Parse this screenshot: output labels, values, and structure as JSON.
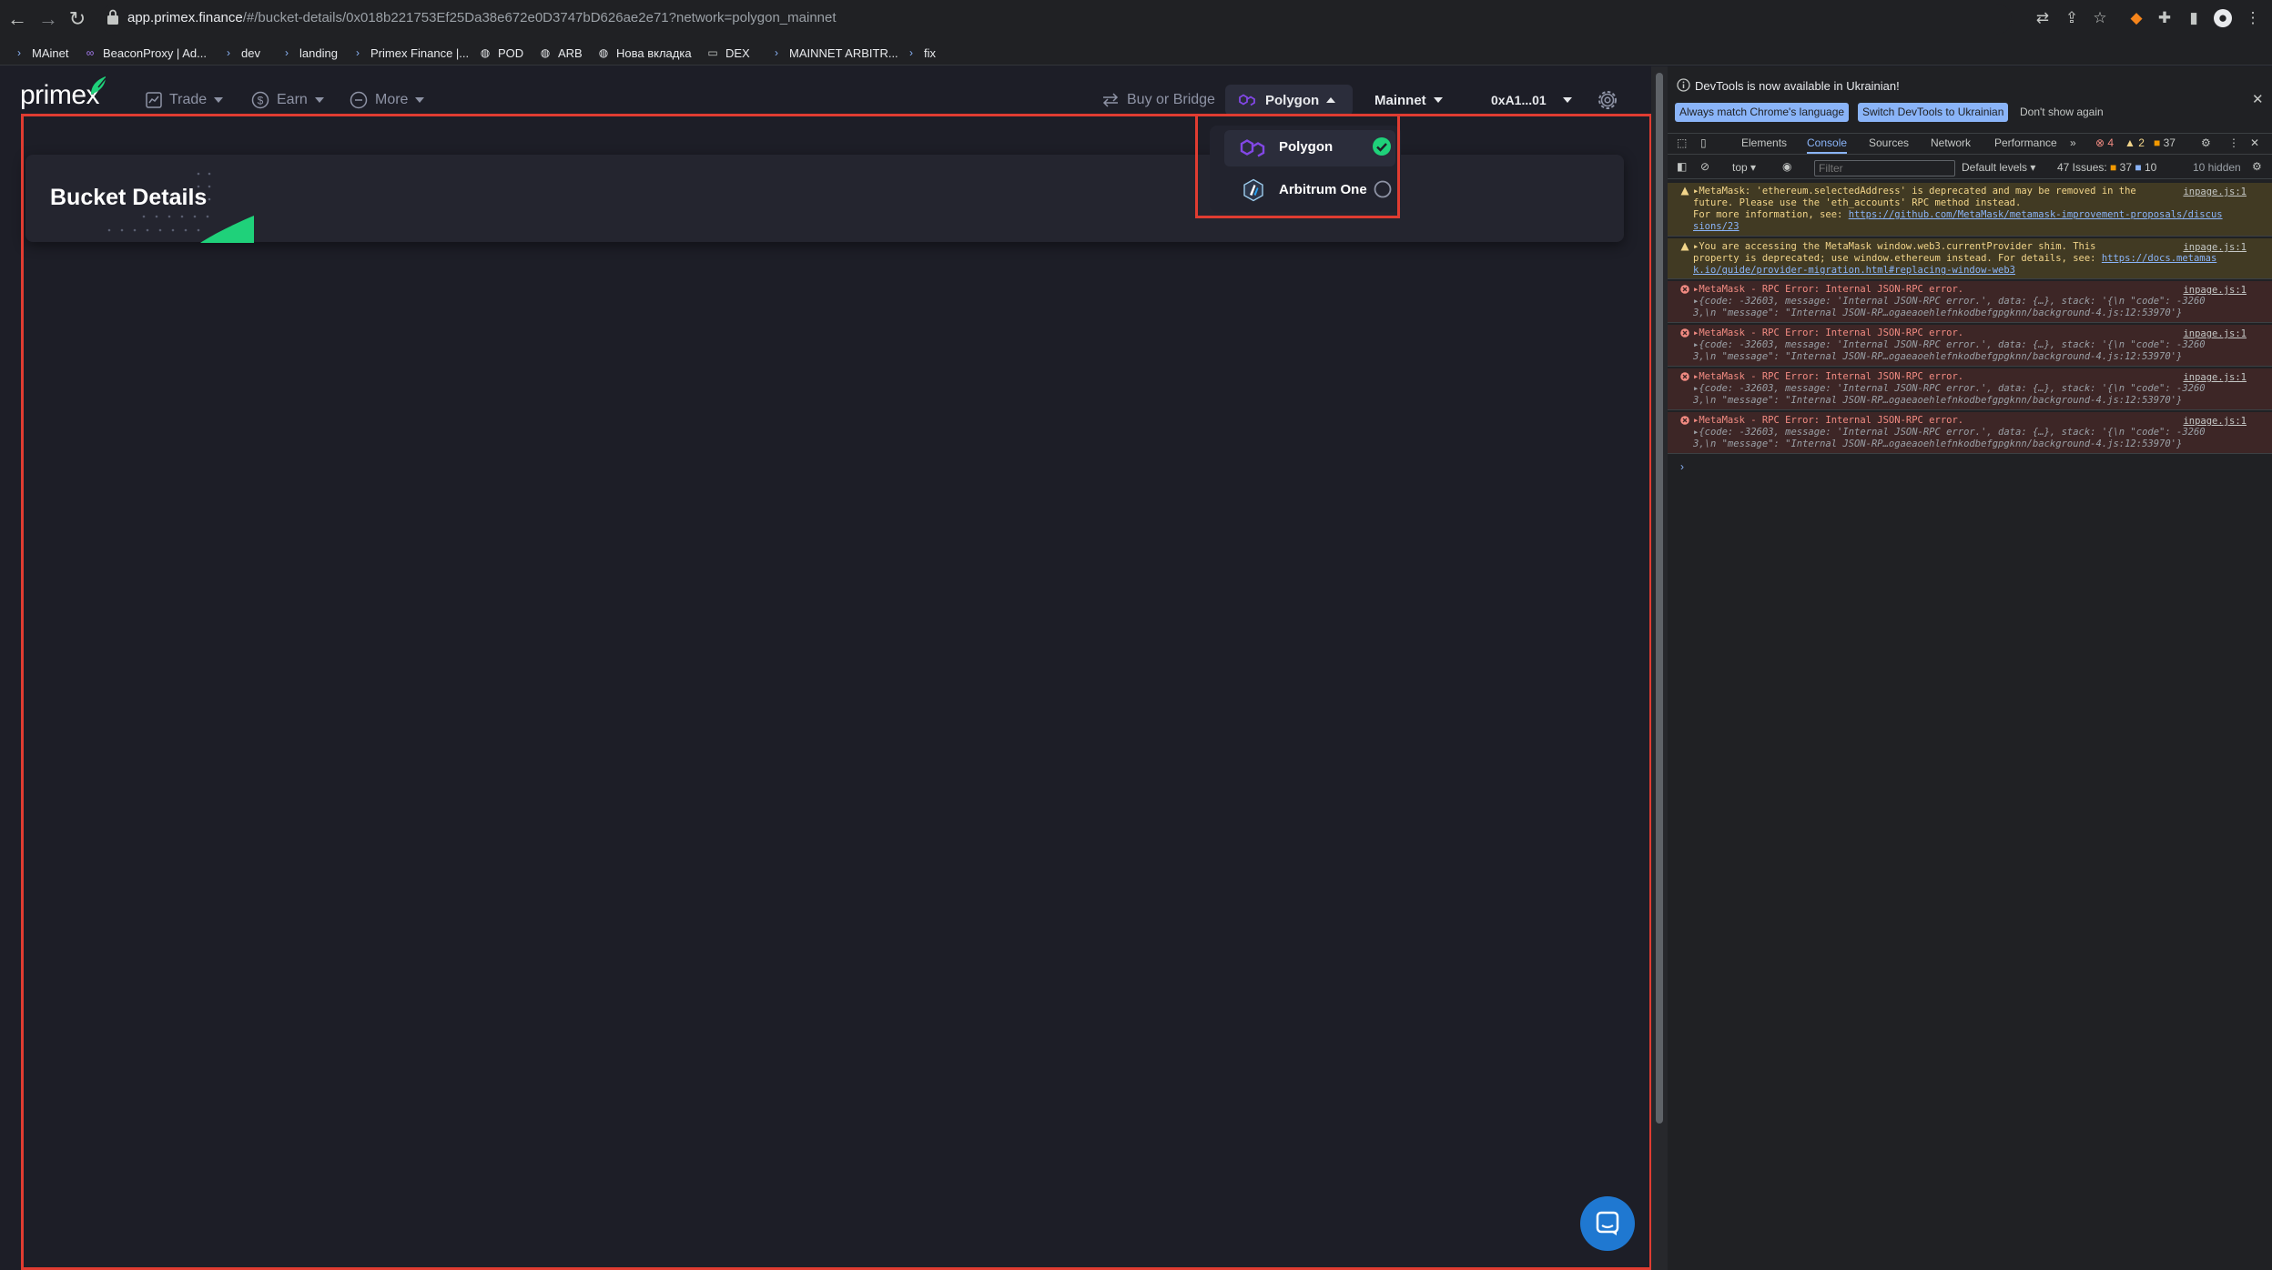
{
  "browser": {
    "url_host": "app.primex.finance",
    "url_path": "/#/bucket-details/0x018b221753Ef25Da38e672e0D3747bD626ae2e71?network=polygon_mainnet",
    "bookmarks": [
      "MAinet",
      "BeaconProxy | Ad...",
      "dev",
      "landing",
      "Primex Finance |...",
      "POD",
      "ARB",
      "Нова вкладка",
      "DEX",
      "MAINNET ARBITR...",
      "fix"
    ]
  },
  "app": {
    "logo": "primex",
    "nav": {
      "trade": "Trade",
      "earn": "Earn",
      "more": "More"
    },
    "buy_or_bridge": "Buy or Bridge",
    "network_selector": "Polygon",
    "environment": "Mainnet",
    "account": "0xA1...01",
    "network_options": [
      {
        "label": "Polygon",
        "selected": true
      },
      {
        "label": "Arbitrum One",
        "selected": false
      }
    ],
    "page_title": "Bucket Details"
  },
  "devtools": {
    "info": "DevTools is now available in Ukrainian!",
    "btn_match": "Always match Chrome's language",
    "btn_switch": "Switch DevTools to Ukrainian",
    "btn_dont_show": "Don't show again",
    "tabs": [
      "Elements",
      "Console",
      "Sources",
      "Network",
      "Performance"
    ],
    "active_tab": "Console",
    "badge_errors": "4",
    "badge_warnings": "2",
    "badge_issues": "37",
    "context": "top",
    "filter_placeholder": "Filter",
    "levels": "Default levels",
    "issues_label": "47 Issues:",
    "issues_warn": "37",
    "issues_info": "10",
    "hidden": "10 hidden",
    "messages": [
      {
        "type": "warn",
        "lines": [
          "▸MetaMask: 'ethereum.selectedAddress' is deprecated and may be removed in the",
          "future. Please use the 'eth_accounts' RPC method instead.",
          "For more information, see: ",
          "sions/23"
        ],
        "link": "https://github.com/MetaMask/metamask-improvement-proposals/discus",
        "source": "inpage.js:1"
      },
      {
        "type": "warn",
        "lines": [
          "▸You are accessing the MetaMask window.web3.currentProvider shim. This",
          "property is deprecated; use window.ethereum instead. For details, see: ",
          "k.io/guide/provider-migration.html#replacing-window-web3"
        ],
        "link": "https://docs.metamas",
        "source": "inpage.js:1"
      },
      {
        "type": "err",
        "lines": [
          "▸MetaMask - RPC Error: Internal JSON-RPC error.",
          "▸{code: -32603, message: 'Internal JSON-RPC error.', data: {…}, stack: '{\\n  \"code\": -3260",
          "3,\\n  \"message\": \"Internal JSON-RP…ogaeaoehlefnkodbefgpgknn/background-4.js:12:53970'}"
        ],
        "source": "inpage.js:1"
      },
      {
        "type": "err",
        "lines": [
          "▸MetaMask - RPC Error: Internal JSON-RPC error.",
          "▸{code: -32603, message: 'Internal JSON-RPC error.', data: {…}, stack: '{\\n  \"code\": -3260",
          "3,\\n  \"message\": \"Internal JSON-RP…ogaeaoehlefnkodbefgpgknn/background-4.js:12:53970'}"
        ],
        "source": "inpage.js:1"
      },
      {
        "type": "err",
        "lines": [
          "▸MetaMask - RPC Error: Internal JSON-RPC error.",
          "▸{code: -32603, message: 'Internal JSON-RPC error.', data: {…}, stack: '{\\n  \"code\": -3260",
          "3,\\n  \"message\": \"Internal JSON-RP…ogaeaoehlefnkodbefgpgknn/background-4.js:12:53970'}"
        ],
        "source": "inpage.js:1"
      },
      {
        "type": "err",
        "lines": [
          "▸MetaMask - RPC Error: Internal JSON-RPC error.",
          "▸{code: -32603, message: 'Internal JSON-RPC error.', data: {…}, stack: '{\\n  \"code\": -3260",
          "3,\\n  \"message\": \"Internal JSON-RP…ogaeaoehlefnkodbefgpgknn/background-4.js:12:53970'}"
        ],
        "source": "inpage.js:1"
      }
    ],
    "prompt": "›"
  },
  "colors": {
    "accent_green": "#1fd17a",
    "polygon_purple": "#8247e5",
    "highlight_red": "#e03c31",
    "chat_blue": "#1f78d1"
  }
}
